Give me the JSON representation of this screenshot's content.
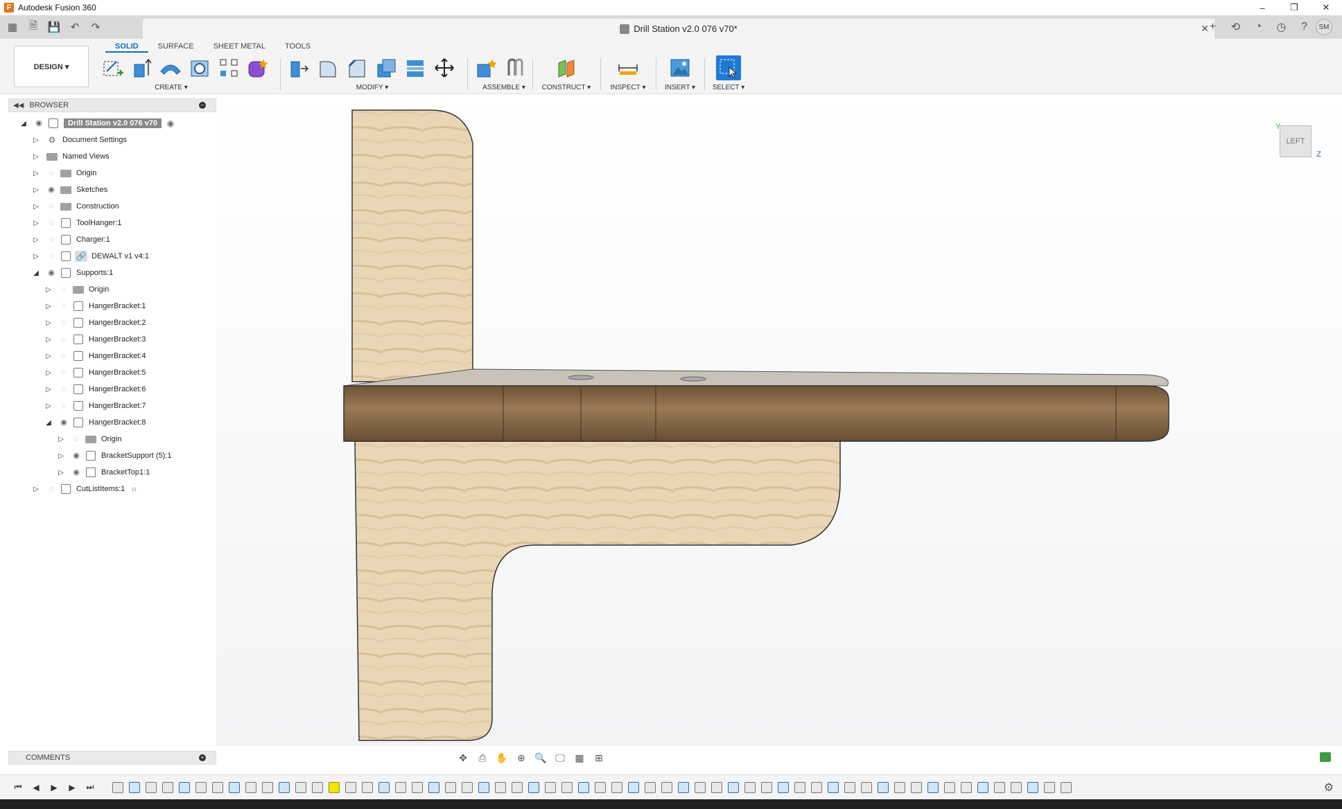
{
  "window": {
    "app_title": "Autodesk Fusion 360",
    "logo_letter": "F",
    "doc_title": "Drill Station v2.0 076 v70*"
  },
  "user": {
    "initials": "SM"
  },
  "ribbon": {
    "workspace": "DESIGN ▾",
    "tabs": [
      "SOLID",
      "SURFACE",
      "SHEET METAL",
      "TOOLS"
    ],
    "groups": {
      "create": "CREATE ▾",
      "modify": "MODIFY ▾",
      "assemble": "ASSEMBLE ▾",
      "construct": "CONSTRUCT ▾",
      "inspect": "INSPECT ▾",
      "insert": "INSERT ▾",
      "select": "SELECT ▾"
    }
  },
  "browser": {
    "title": "BROWSER",
    "root": "Drill Station v2.0 076 v70",
    "items": [
      "Document Settings",
      "Named Views",
      "Origin",
      "Sketches",
      "Construction",
      "ToolHanger:1",
      "Charger:1",
      "DEWALT v1 v4:1",
      "Supports:1",
      "Origin",
      "HangerBracket:1",
      "HangerBracket:2",
      "HangerBracket:3",
      "HangerBracket:4",
      "HangerBracket:5",
      "HangerBracket:6",
      "HangerBracket:7",
      "HangerBracket:8",
      "Origin",
      "BracketSupport (5):1",
      "BracketTop1:1",
      "CutListItems:1"
    ]
  },
  "viewcube": {
    "face": "LEFT",
    "axis_y": "Y",
    "axis_z": "Z"
  },
  "comments": {
    "title": "COMMENTS"
  },
  "colors": {
    "accent": "#0d6fb8",
    "wood_light": "#e7d3b1",
    "wood_dark": "#8a6a46"
  }
}
